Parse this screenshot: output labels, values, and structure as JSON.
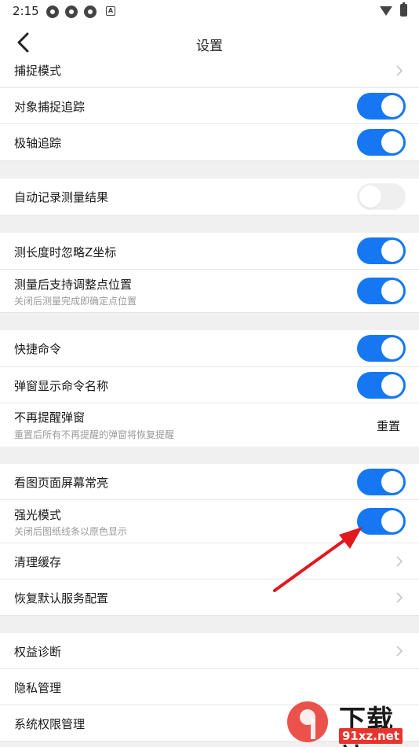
{
  "status_bar": {
    "time": "2:15",
    "icon_letter": "A"
  },
  "header": {
    "title": "设置"
  },
  "rows": [
    {
      "label": "捕捉模式",
      "control": "chevron"
    },
    {
      "label": "对象捕捉追踪",
      "control": "toggle",
      "on": true
    },
    {
      "label": "极轴追踪",
      "control": "toggle",
      "on": true
    },
    {
      "label": "自动记录测量结果",
      "control": "toggle",
      "on": false
    },
    {
      "label": "测长度时忽略Z坐标",
      "control": "toggle",
      "on": true
    },
    {
      "label": "测量后支持调整点位置",
      "sublabel": "关闭后测量完成即确定点位置",
      "control": "toggle",
      "on": true
    },
    {
      "label": "快捷命令",
      "control": "toggle",
      "on": true
    },
    {
      "label": "弹窗显示命令名称",
      "control": "toggle",
      "on": true
    },
    {
      "label": "不再提醒弹窗",
      "sublabel": "重置后所有不再提醒的弹窗将恢复提醒",
      "control": "action",
      "action_label": "重置"
    },
    {
      "label": "看图页面屏幕常亮",
      "control": "toggle",
      "on": true
    },
    {
      "label": "强光模式",
      "sublabel": "关闭后图纸线条以原色显示",
      "control": "toggle",
      "on": true
    },
    {
      "label": "清理缓存",
      "control": "chevron"
    },
    {
      "label": "恢复默认服务配置",
      "control": "chevron"
    },
    {
      "label": "权益诊断",
      "control": "chevron"
    },
    {
      "label": "隐私管理",
      "control": "none"
    },
    {
      "label": "系统权限管理",
      "control": "none"
    }
  ],
  "watermark": {
    "text": "下载站",
    "url": "91xz.net"
  },
  "colors": {
    "accent": "#1677f2",
    "arrow": "#e0191f",
    "background": "#f0f0f0"
  }
}
